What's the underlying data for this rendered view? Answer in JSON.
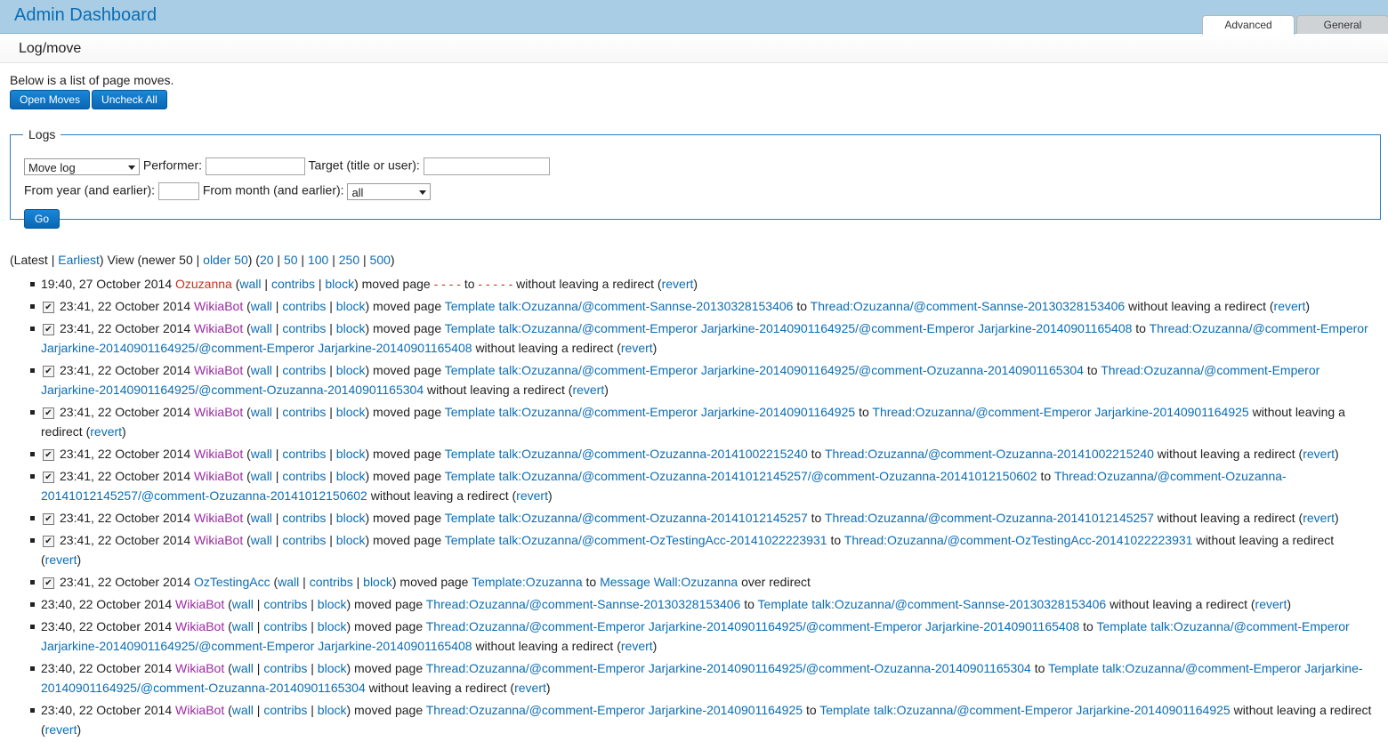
{
  "app_title": "Admin Dashboard",
  "tabs": [
    "Advanced",
    "General"
  ],
  "breadcrumb": "Log/move",
  "intro": "Below is a list of page moves.",
  "buttons": {
    "open_moves": "Open Moves",
    "uncheck_all": "Uncheck All"
  },
  "logs": {
    "legend": "Logs",
    "type_selected": "Move log",
    "performer_label": "Performer:",
    "target_label": "Target (title or user):",
    "year_label": "From year (and earlier):",
    "month_label": "From month (and earlier):",
    "month_selected": "all",
    "go": "Go"
  },
  "nav": {
    "latest": "Latest",
    "earliest": "Earliest",
    "view": "View",
    "newer": "newer 50",
    "older": "older 50",
    "limits": [
      "20",
      "50",
      "100",
      "250",
      "500"
    ]
  },
  "text": {
    "wall": "wall",
    "contribs": "contribs",
    "block": "block",
    "moved_page": "moved page",
    "to": "to",
    "no_redirect": "without leaving a redirect",
    "over_redirect": "over redirect",
    "revert": "revert"
  },
  "entries": [
    {
      "checkbox": false,
      "time": "19:40, 27 October 2014",
      "user": "Ozuzanna",
      "user_color": "#c5331c",
      "from": "- - - -",
      "to": "- - - - -",
      "from_color": "#c5331c",
      "to_color": "#c5331c",
      "suffix": "without leaving a redirect",
      "revert": true
    },
    {
      "checkbox": true,
      "time": "23:41, 22 October 2014",
      "user": "WikiaBot",
      "user_color": "#9c2aa3",
      "from": "Template talk:Ozuzanna/@comment-Sannse-20130328153406",
      "to": "Thread:Ozuzanna/@comment-Sannse-20130328153406",
      "suffix": "without leaving a redirect",
      "revert": true
    },
    {
      "checkbox": true,
      "time": "23:41, 22 October 2014",
      "user": "WikiaBot",
      "user_color": "#9c2aa3",
      "from": "Template talk:Ozuzanna/@comment-Emperor Jarjarkine-20140901164925/@comment-Emperor Jarjarkine-20140901165408",
      "to": "Thread:Ozuzanna/@comment-Emperor Jarjarkine-20140901164925/@comment-Emperor Jarjarkine-20140901165408",
      "suffix": "without leaving a redirect",
      "revert": true
    },
    {
      "checkbox": true,
      "time": "23:41, 22 October 2014",
      "user": "WikiaBot",
      "user_color": "#9c2aa3",
      "from": "Template talk:Ozuzanna/@comment-Emperor Jarjarkine-20140901164925/@comment-Ozuzanna-20140901165304",
      "to": "Thread:Ozuzanna/@comment-Emperor Jarjarkine-20140901164925/@comment-Ozuzanna-20140901165304",
      "suffix": "without leaving a redirect",
      "revert": true
    },
    {
      "checkbox": true,
      "time": "23:41, 22 October 2014",
      "user": "WikiaBot",
      "user_color": "#9c2aa3",
      "from": "Template talk:Ozuzanna/@comment-Emperor Jarjarkine-20140901164925",
      "to": "Thread:Ozuzanna/@comment-Emperor Jarjarkine-20140901164925",
      "suffix": "without leaving a redirect",
      "revert": true
    },
    {
      "checkbox": true,
      "time": "23:41, 22 October 2014",
      "user": "WikiaBot",
      "user_color": "#9c2aa3",
      "from": "Template talk:Ozuzanna/@comment-Ozuzanna-20141002215240",
      "to": "Thread:Ozuzanna/@comment-Ozuzanna-20141002215240",
      "suffix": "without leaving a redirect",
      "revert": true
    },
    {
      "checkbox": true,
      "time": "23:41, 22 October 2014",
      "user": "WikiaBot",
      "user_color": "#9c2aa3",
      "from": "Template talk:Ozuzanna/@comment-Ozuzanna-20141012145257/@comment-Ozuzanna-20141012150602",
      "to": "Thread:Ozuzanna/@comment-Ozuzanna-20141012145257/@comment-Ozuzanna-20141012150602",
      "suffix": "without leaving a redirect",
      "revert": true
    },
    {
      "checkbox": true,
      "time": "23:41, 22 October 2014",
      "user": "WikiaBot",
      "user_color": "#9c2aa3",
      "from": "Template talk:Ozuzanna/@comment-Ozuzanna-20141012145257",
      "to": "Thread:Ozuzanna/@comment-Ozuzanna-20141012145257",
      "suffix": "without leaving a redirect",
      "revert": true
    },
    {
      "checkbox": true,
      "time": "23:41, 22 October 2014",
      "user": "WikiaBot",
      "user_color": "#9c2aa3",
      "from": "Template talk:Ozuzanna/@comment-OzTestingAcc-20141022223931",
      "to": "Thread:Ozuzanna/@comment-OzTestingAcc-20141022223931",
      "suffix": "without leaving a redirect",
      "revert": true
    },
    {
      "checkbox": true,
      "time": "23:41, 22 October 2014",
      "user": "OzTestingAcc",
      "user_color": "#0b6db5",
      "from": "Template:Ozuzanna",
      "to": "Message Wall:Ozuzanna",
      "suffix": "over redirect",
      "revert": false
    },
    {
      "checkbox": false,
      "time": "23:40, 22 October 2014",
      "user": "WikiaBot",
      "user_color": "#9c2aa3",
      "from": "Thread:Ozuzanna/@comment-Sannse-20130328153406",
      "to": "Template talk:Ozuzanna/@comment-Sannse-20130328153406",
      "suffix": "without leaving a redirect",
      "revert": true
    },
    {
      "checkbox": false,
      "time": "23:40, 22 October 2014",
      "user": "WikiaBot",
      "user_color": "#9c2aa3",
      "from": "Thread:Ozuzanna/@comment-Emperor Jarjarkine-20140901164925/@comment-Emperor Jarjarkine-20140901165408",
      "to": "Template talk:Ozuzanna/@comment-Emperor Jarjarkine-20140901164925/@comment-Emperor Jarjarkine-20140901165408",
      "suffix": "without leaving a redirect",
      "revert": true
    },
    {
      "checkbox": false,
      "time": "23:40, 22 October 2014",
      "user": "WikiaBot",
      "user_color": "#9c2aa3",
      "from": "Thread:Ozuzanna/@comment-Emperor Jarjarkine-20140901164925/@comment-Ozuzanna-20140901165304",
      "to": "Template talk:Ozuzanna/@comment-Emperor Jarjarkine-20140901164925/@comment-Ozuzanna-20140901165304",
      "suffix": "without leaving a redirect",
      "revert": true
    },
    {
      "checkbox": false,
      "time": "23:40, 22 October 2014",
      "user": "WikiaBot",
      "user_color": "#9c2aa3",
      "from": "Thread:Ozuzanna/@comment-Emperor Jarjarkine-20140901164925",
      "to": "Template talk:Ozuzanna/@comment-Emperor Jarjarkine-20140901164925",
      "suffix": "without leaving a redirect",
      "revert": true
    }
  ]
}
